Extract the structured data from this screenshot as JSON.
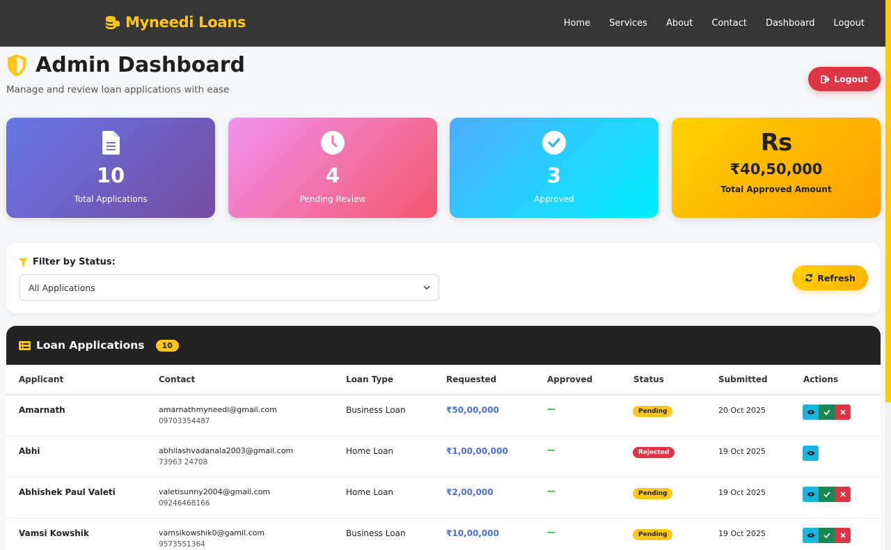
{
  "brand": {
    "name": "Myneedi Loans",
    "color": "#ffc61a"
  },
  "nav": [
    {
      "label": "Home"
    },
    {
      "label": "Services"
    },
    {
      "label": "About"
    },
    {
      "label": "Contact"
    },
    {
      "label": "Dashboard"
    },
    {
      "label": "Logout"
    }
  ],
  "header": {
    "title": "Admin Dashboard",
    "subtitle": "Manage and review loan applications with ease",
    "logout_label": "Logout"
  },
  "stats": [
    {
      "icon": "document-icon",
      "value": "10",
      "label": "Total Applications"
    },
    {
      "icon": "clock-icon",
      "value": "4",
      "label": "Pending Review"
    },
    {
      "icon": "check-circle-icon",
      "value": "3",
      "label": "Approved"
    },
    {
      "icon": "rupee-icon",
      "icon_text": "Rs",
      "value": "₹40,50,000",
      "label": "Total Approved Amount"
    }
  ],
  "filter": {
    "label": "Filter by Status:",
    "selected": "All Applications",
    "refresh_label": "Refresh"
  },
  "table": {
    "title": "Loan Applications",
    "count": "10",
    "columns": [
      "Applicant",
      "Contact",
      "Loan Type",
      "Requested",
      "Approved",
      "Status",
      "Submitted",
      "Actions"
    ],
    "rows": [
      {
        "name": "Amarnath",
        "email": "amarnathmyneedi@gmail.com",
        "phone": "09703354487",
        "type": "Business Loan",
        "requested": "₹50,00,000",
        "approved": "—",
        "status": "Pending",
        "submitted": "20 Oct 2025"
      },
      {
        "name": "Abhi",
        "email": "abhilashvadanala2003@gmail.com",
        "phone": "73963 24708",
        "type": "Home Loan",
        "requested": "₹1,00,00,000",
        "approved": "—",
        "status": "Rejected",
        "submitted": "19 Oct 2025"
      },
      {
        "name": "Abhishek Paul Valeti",
        "email": "valetisunny2004@gmail.com",
        "phone": "09246468166",
        "type": "Home Loan",
        "requested": "₹2,00,000",
        "approved": "—",
        "status": "Pending",
        "submitted": "19 Oct 2025"
      },
      {
        "name": "Vamsi Kowshik",
        "email": "vamsikowshik0@gamil.com",
        "phone": "9573551364",
        "type": "Business Loan",
        "requested": "₹10,00,000",
        "approved": "—",
        "status": "Pending",
        "submitted": "19 Oct 2025"
      }
    ]
  }
}
